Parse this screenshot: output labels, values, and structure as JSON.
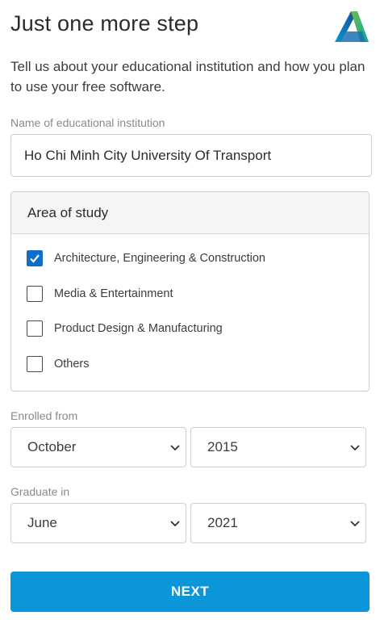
{
  "header": {
    "title": "Just one more step",
    "logo": "autodesk-logo"
  },
  "intro": "Tell us about your educational institution and how you plan to use your free software.",
  "institution": {
    "label": "Name of educational institution",
    "value": "Ho Chi Minh City University Of Transport"
  },
  "area_of_study": {
    "title": "Area of study",
    "options": [
      {
        "label": "Architecture, Engineering & Construction",
        "checked": true
      },
      {
        "label": "Media & Entertainment",
        "checked": false
      },
      {
        "label": "Product Design & Manufacturing",
        "checked": false
      },
      {
        "label": "Others",
        "checked": false
      }
    ]
  },
  "enrolled": {
    "label": "Enrolled from",
    "month": "October",
    "year": "2015"
  },
  "graduate": {
    "label": "Graduate in",
    "month": "June",
    "year": "2021"
  },
  "next_label": "NEXT",
  "colors": {
    "accent": "#0b96d9",
    "checkbox": "#0d6fc9"
  }
}
